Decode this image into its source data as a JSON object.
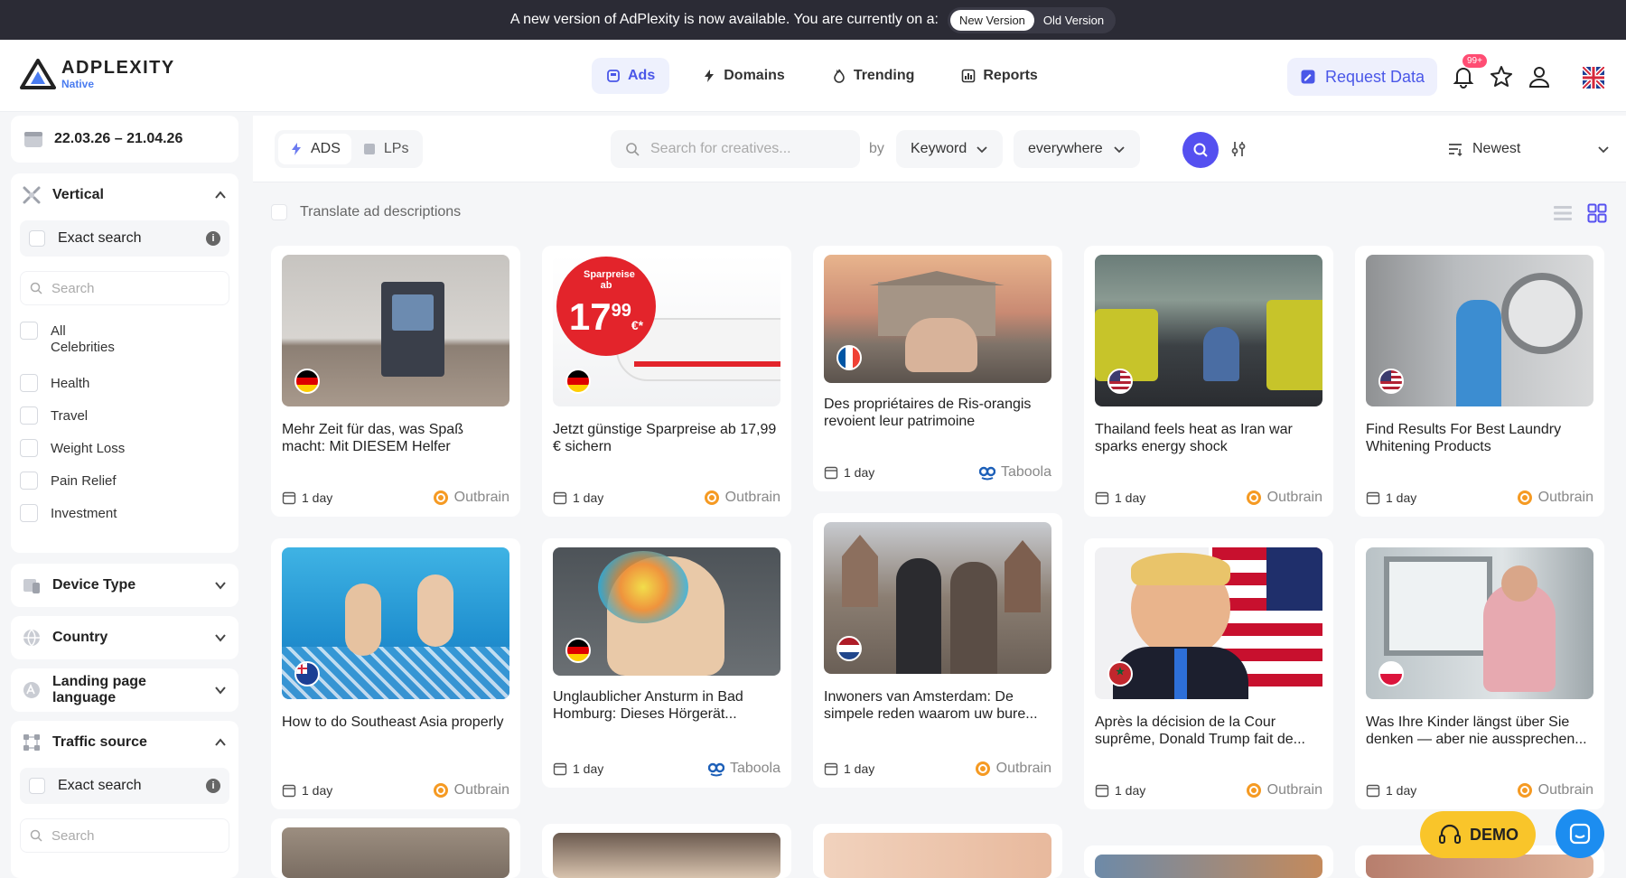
{
  "banner": {
    "message": "A new version of AdPlexity is now available. You are currently on a:",
    "new_version": "New Version",
    "old_version": "Old Version"
  },
  "logo": {
    "brand": "ADPLEXITY",
    "sub": "Native"
  },
  "nav": [
    {
      "label": "Ads",
      "icon": "ads-icon",
      "active": true
    },
    {
      "label": "Domains",
      "icon": "bolt-icon",
      "active": false
    },
    {
      "label": "Trending",
      "icon": "flame-icon",
      "active": false
    },
    {
      "label": "Reports",
      "icon": "chart-icon",
      "active": false
    }
  ],
  "header": {
    "request_data": "Request Data",
    "notification_count": "99+"
  },
  "sidebar": {
    "date_range": "22.03.26 – 21.04.26",
    "vertical": {
      "title": "Vertical",
      "exact_search": "Exact search",
      "search_placeholder": "Search",
      "items": [
        "All",
        "Celebrities",
        "Health",
        "Travel",
        "Weight Loss",
        "Pain Relief",
        "Investment"
      ]
    },
    "device_type": "Device Type",
    "country": "Country",
    "landing_page_language": "Landing page language",
    "traffic_source": {
      "title": "Traffic source",
      "exact_search": "Exact search",
      "search_placeholder": "Search"
    }
  },
  "toolbar": {
    "seg_ads": "ADS",
    "seg_lps": "LPs",
    "search_placeholder": "Search for creatives...",
    "by": "by",
    "keyword": "Keyword",
    "scope": "everywhere",
    "sort": "Newest",
    "translate": "Translate ad descriptions"
  },
  "cards": [
    {
      "title": "Mehr Zeit für das, was Spaß macht: Mit DIESEM Helfer",
      "age": "1 day",
      "network": "Outbrain",
      "flag": "de"
    },
    {
      "title": "Jetzt günstige Sparpreise ab 17,99 € sichern",
      "age": "1 day",
      "network": "Outbrain",
      "flag": "de",
      "promo": {
        "top": "Sparpreise ab",
        "price": "17",
        "cents": "99",
        "cur": "€*"
      }
    },
    {
      "title": "Des propriétaires de Ris-orangis revoient leur patrimoine",
      "age": "1 day",
      "network": "Taboola",
      "flag": "fr"
    },
    {
      "title": "Thailand feels heat as Iran war sparks energy shock",
      "age": "1 day",
      "network": "Outbrain",
      "flag": "us"
    },
    {
      "title": "Find Results For Best Laundry Whitening Products",
      "age": "1 day",
      "network": "Outbrain",
      "flag": "us"
    },
    {
      "title": "How to do Southeast Asia properly",
      "age": "1 day",
      "network": "Outbrain",
      "flag": "au"
    },
    {
      "title": "Unglaublicher Ansturm in Bad Homburg: Dieses Hörgerät...",
      "age": "1 day",
      "network": "Taboola",
      "flag": "de"
    },
    {
      "title": "Inwoners van Amsterdam: De simpele reden waarom uw bure...",
      "age": "1 day",
      "network": "Outbrain",
      "flag": "nl"
    },
    {
      "title": "Après la décision de la Cour suprême, Donald Trump fait de...",
      "age": "1 day",
      "network": "Outbrain",
      "flag": "ma"
    },
    {
      "title": "Was Ihre Kinder längst über Sie denken — aber nie aussprechen...",
      "age": "1 day",
      "network": "Outbrain",
      "flag": "pl"
    }
  ],
  "widgets": {
    "demo": "DEMO"
  },
  "colors": {
    "accent": "#4a57e8",
    "search_button": "#5550f0",
    "demo": "#f9c52a",
    "chat": "#1c8df0",
    "badge": "#ff4d73"
  }
}
